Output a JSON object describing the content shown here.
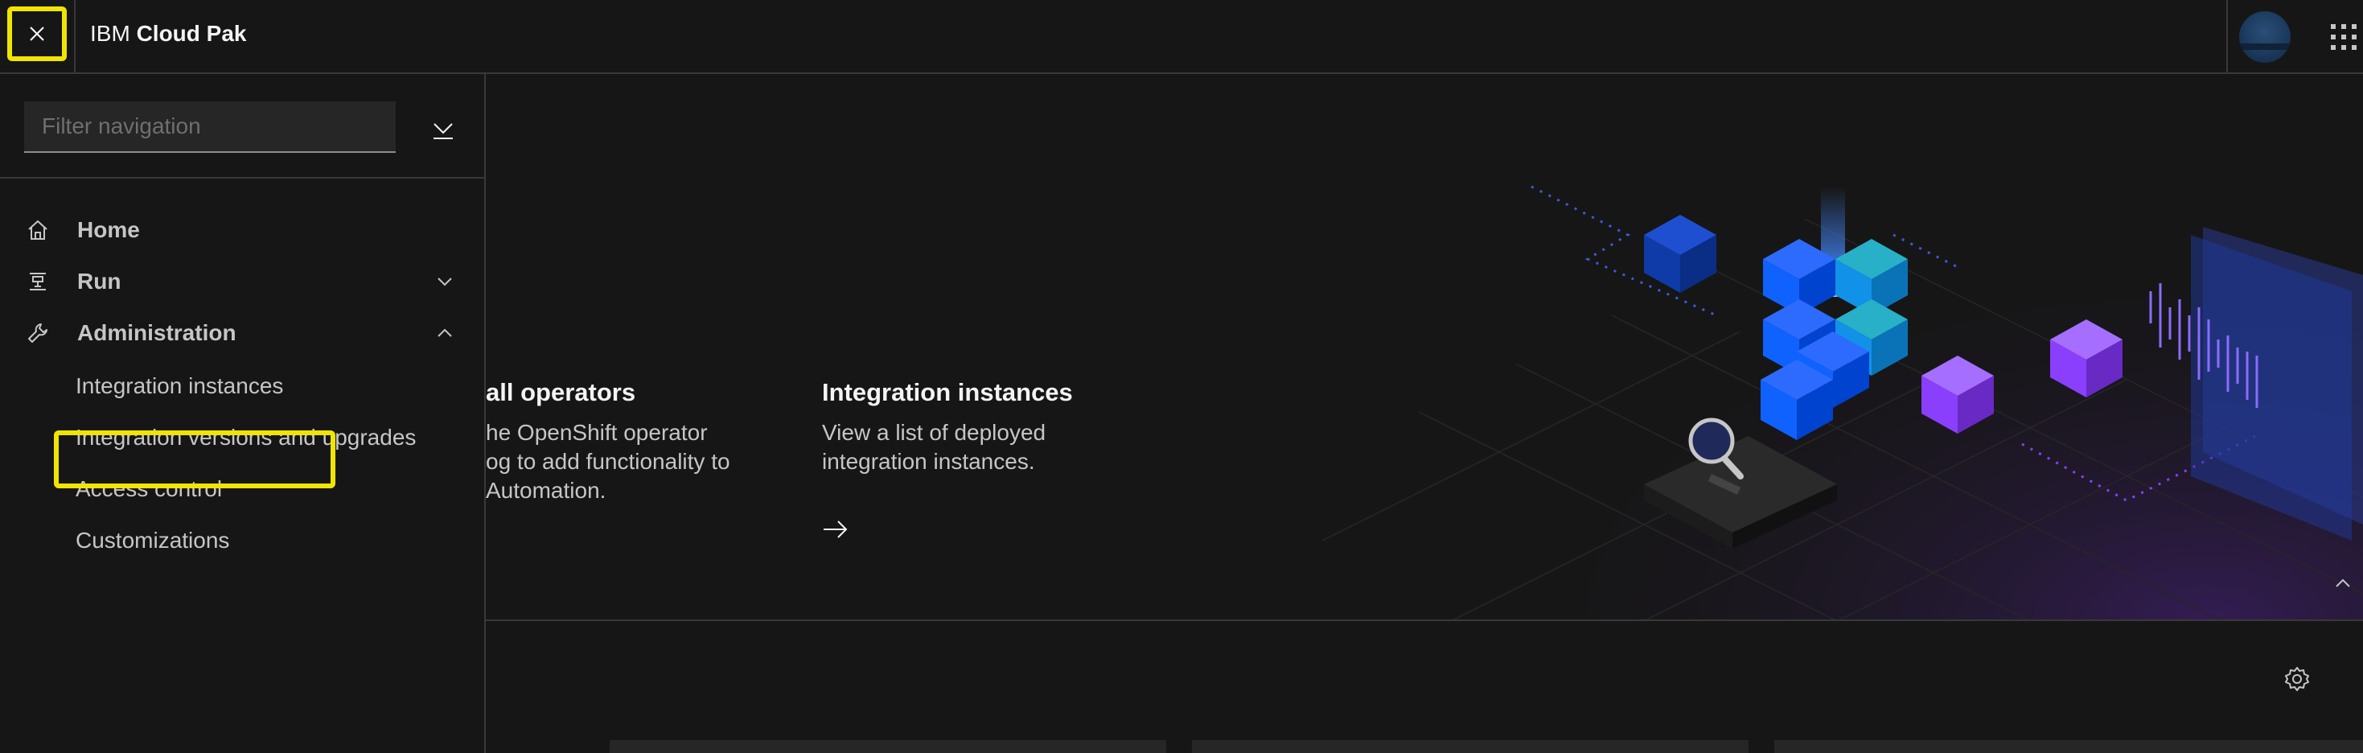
{
  "header": {
    "brand_prefix": "IBM",
    "brand_name": "Cloud Pak",
    "close_icon": "close-icon",
    "avatar_icon": "user-avatar",
    "switcher_icon": "app-switcher-icon"
  },
  "sidenav": {
    "filter_placeholder": "Filter navigation",
    "items": [
      {
        "label": "Home",
        "icon": "home-icon"
      },
      {
        "label": "Run",
        "icon": "run-icon",
        "chevron": "chevron-down-icon"
      },
      {
        "label": "Administration",
        "icon": "wrench-icon",
        "chevron": "chevron-up-icon"
      }
    ],
    "admin_children": [
      {
        "label": "Integration instances"
      },
      {
        "label": "Integration versions and upgrades"
      },
      {
        "label": "Access control"
      },
      {
        "label": "Customizations"
      }
    ]
  },
  "hero": {
    "card1": {
      "title": "all operators",
      "desc_lines": [
        "he OpenShift operator",
        "og to add functionality to",
        " Automation."
      ]
    },
    "card2": {
      "title": "Integration instances",
      "desc_lines": [
        "View a list of deployed",
        "integration instances."
      ]
    }
  },
  "colors": {
    "background": "#161616",
    "highlight": "#f1e400",
    "cube_blue": "#0f62fe",
    "cube_teal": "#1192e8",
    "cube_purple": "#8a3ffc"
  }
}
